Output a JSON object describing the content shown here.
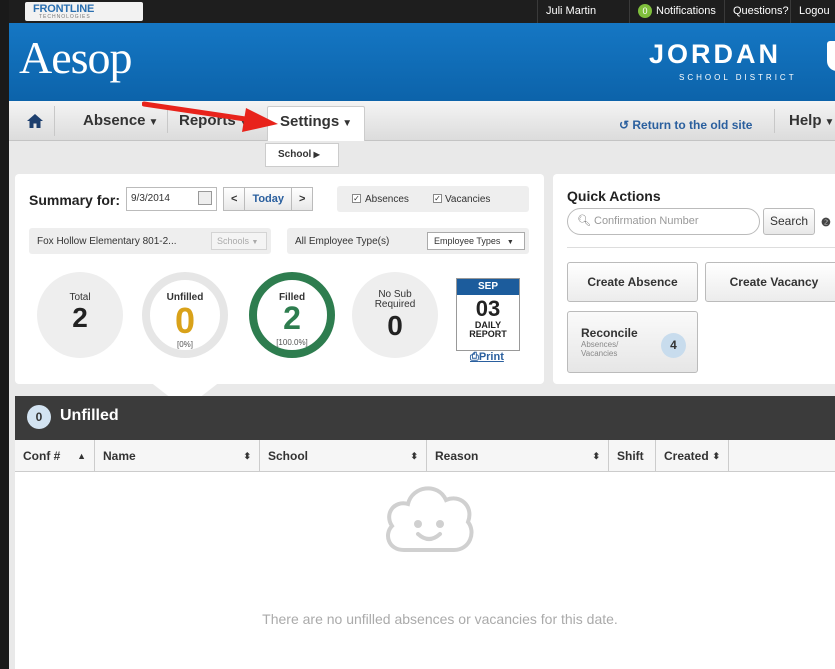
{
  "topbar": {
    "brand": "FRONTLINE",
    "brand_sub": "TECHNOLOGIES",
    "user": "Juli Martin",
    "notifications_count": "0",
    "notifications_label": "Notifications",
    "questions": "Questions?",
    "logout": "Logou"
  },
  "banner": {
    "app_name": "Aesop",
    "district_name": "JORDAN",
    "district_sub": "SCHOOL DISTRICT"
  },
  "nav": {
    "absence": "Absence",
    "reports": "Reports",
    "settings": "Settings",
    "return_link": "Return to the old site",
    "help": "Help"
  },
  "submenu": {
    "school": "School"
  },
  "summary": {
    "title": "Summary for:",
    "date": "9/3/2014",
    "today": "Today",
    "absences": "Absences",
    "vacancies": "Vacancies",
    "school_name": "Fox Hollow Elementary 801-2...",
    "schools_select": "Schools",
    "employee_type": "All Employee Type(s)",
    "employee_select": "Employee Types",
    "total_label": "Total",
    "total_value": "2",
    "unfilled_label": "Unfilled",
    "unfilled_value": "0",
    "unfilled_pct": "[0%]",
    "filled_label": "Filled",
    "filled_value": "2",
    "filled_pct": "[100.0%]",
    "nosub_label_1": "No Sub",
    "nosub_label_2": "Required",
    "nosub_value": "0",
    "daily_month": "SEP",
    "daily_day": "03",
    "daily_line1": "DAILY",
    "daily_line2": "REPORT",
    "print": "Print"
  },
  "quick_actions": {
    "title": "Quick Actions",
    "conf_placeholder": "Confirmation Number",
    "search": "Search",
    "create_absence": "Create Absence",
    "create_vacancy": "Create Vacancy",
    "reconcile": "Reconcile",
    "reconcile_sub_1": "Absences/",
    "reconcile_sub_2": "Vacancies",
    "reconcile_count": "4"
  },
  "unfilled": {
    "count": "0",
    "title": "Unfilled",
    "columns": [
      "Conf #",
      "Name",
      "School",
      "Reason",
      "Shift",
      "Created"
    ],
    "empty_message": "There are no unfilled absences or vacancies for this date."
  },
  "colors": {
    "banner_blue": "#0c63aa",
    "filled_green": "#2e7d4f",
    "unfilled_gold": "#d9a21a",
    "link_blue": "#2a5f9e"
  }
}
